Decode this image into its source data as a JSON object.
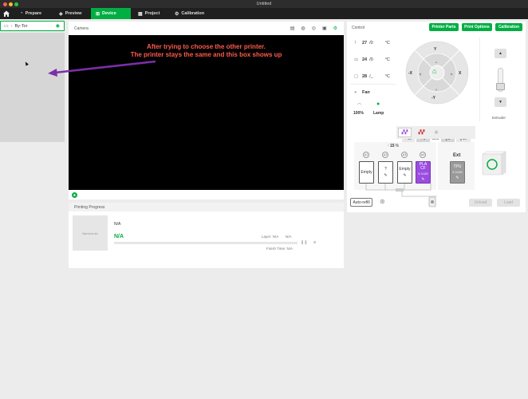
{
  "window": {
    "title": "Untitled"
  },
  "nav": {
    "tabs": [
      {
        "label": "Prepare",
        "icon": "cube-icon"
      },
      {
        "label": "Preview",
        "icon": "layers-icon"
      },
      {
        "label": "Device",
        "icon": "device-icon"
      },
      {
        "label": "Project",
        "icon": "project-icon"
      },
      {
        "label": "Calibration",
        "icon": "calibration-icon"
      }
    ],
    "active": "Device"
  },
  "sidebar": {
    "printer_name": "By-Tor"
  },
  "camera": {
    "title": "Camera",
    "annotation_line1": "After trying to choose the other printer.",
    "annotation_line2": "The printer stays the same and this box shows up"
  },
  "progress": {
    "title": "Printing Progress",
    "thumbnail_text": "BambuLab",
    "task_name": "N/A",
    "percent": "N/A",
    "layer_label": "Layer: N/A",
    "layer_value": "N/A",
    "finish_label": "Finish Time: N/A"
  },
  "control": {
    "title": "Control",
    "buttons": {
      "printer_parts": "Printer Parts",
      "print_options": "Print Options",
      "calibration": "Calibration"
    },
    "temps": [
      {
        "icon": "nozzle-icon",
        "current": "27",
        "target": "/0",
        "unit": "°C"
      },
      {
        "icon": "bed-icon",
        "current": "24",
        "target": "/0",
        "unit": "°C"
      },
      {
        "icon": "chamber-icon",
        "current": "28",
        "target": "/_",
        "unit": "°C"
      }
    ],
    "fan_label": "Fan",
    "speed_value": "100%",
    "lamp_label": "Lamp",
    "dial": {
      "y_plus": "Y",
      "y_minus": "-Y",
      "x_minus": "-X",
      "x_plus": "X",
      "home_icon": "home-icon"
    },
    "bed_steps": [
      {
        "dir": "up",
        "value": "10"
      },
      {
        "dir": "up",
        "value": "1"
      },
      {
        "label": "Bed"
      },
      {
        "dir": "down",
        "value": "1"
      },
      {
        "dir": "down",
        "value": "10"
      }
    ],
    "extruder_label": "Extruder",
    "humidity": "15",
    "humidity_unit": "%",
    "ams_slots": [
      {
        "num": "A1",
        "label": "Empty",
        "sub": ""
      },
      {
        "num": "A2",
        "label": "?",
        "sub": ""
      },
      {
        "num": "A3",
        "label": "Empty",
        "sub": ""
      },
      {
        "num": "A4",
        "label": "PLA CF",
        "sub": "K 0.020"
      }
    ],
    "ext": {
      "title": "Ext",
      "label": "TPU",
      "sub": "K 0.020"
    },
    "auto_refill": "Auto-refill",
    "unload": "Unload",
    "load": "Load",
    "colors": {
      "accent": "#00ae42",
      "pla_cf": "#9b4de0",
      "tpu": "#9a9a9a"
    }
  }
}
